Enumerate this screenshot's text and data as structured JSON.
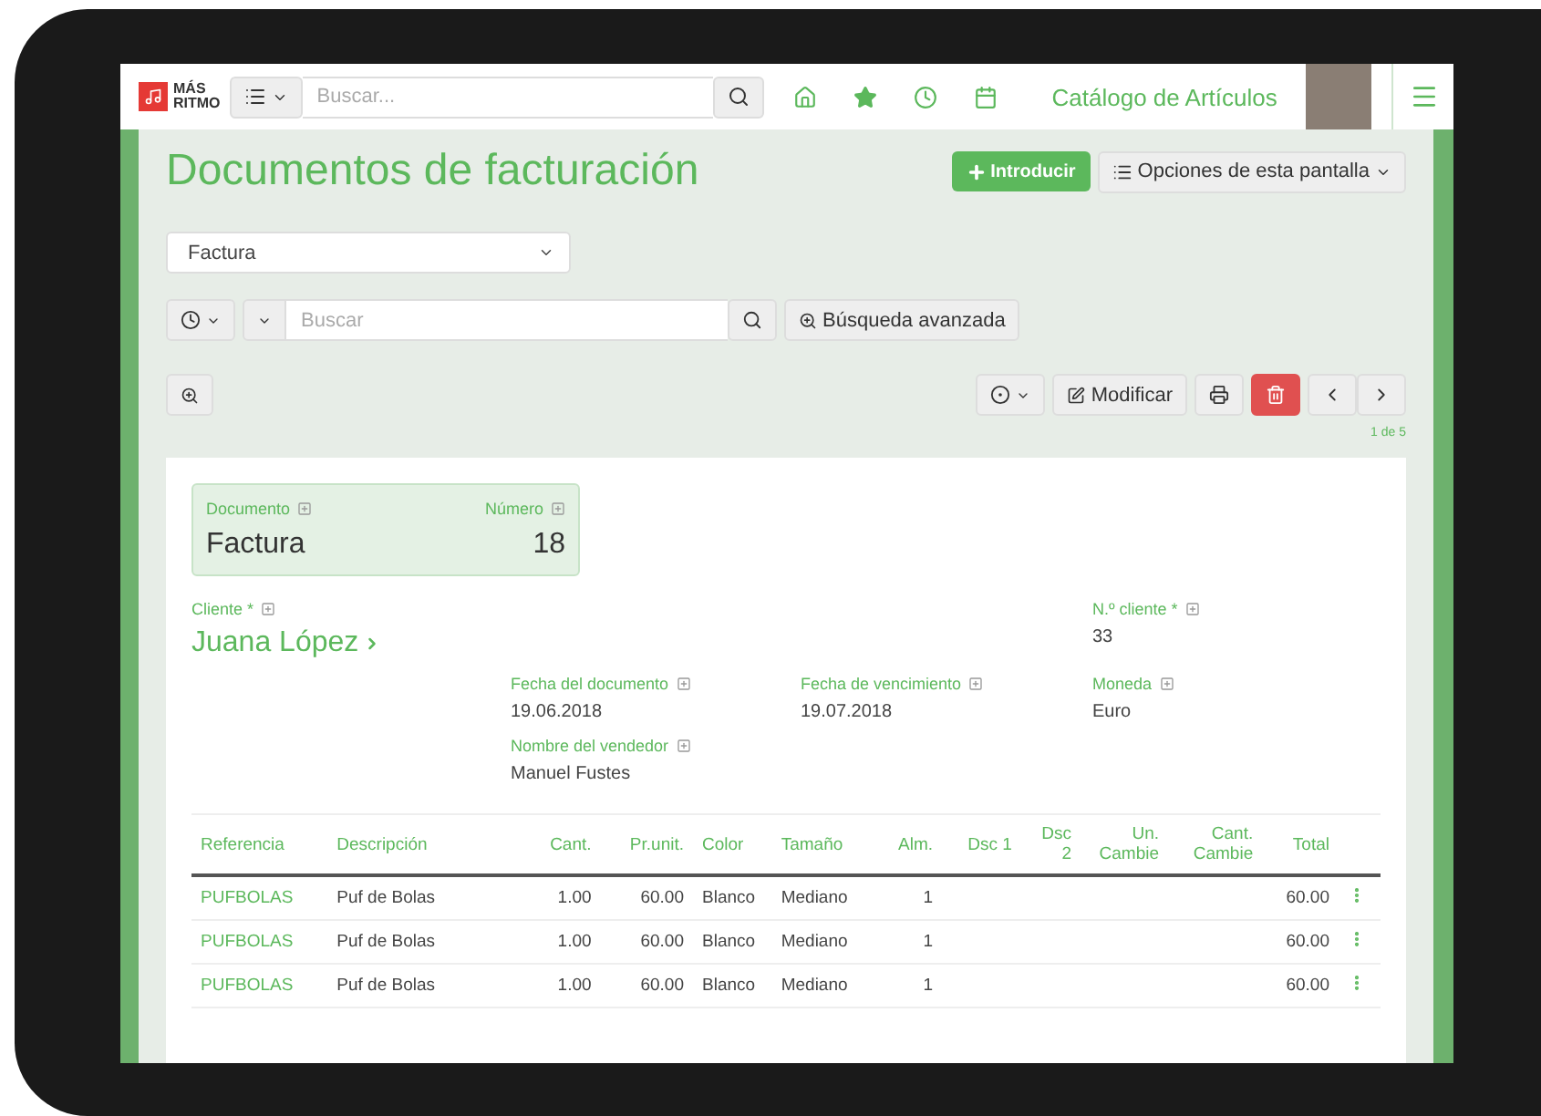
{
  "navbar": {
    "logo_lines": [
      "MÁS",
      "RITMO"
    ],
    "search_placeholder": "Buscar...",
    "module_title": "Catálogo de Artículos"
  },
  "page": {
    "title": "Documentos de facturación",
    "primary_button": "Introducir",
    "options_button": "Opciones de esta pantalla"
  },
  "doc_type_select": {
    "value": "Factura"
  },
  "search": {
    "placeholder": "Buscar",
    "advanced_button": "Búsqueda avanzada"
  },
  "toolbar": {
    "edit_button": "Modificar",
    "pager": "1 de 5"
  },
  "record": {
    "header_fields": [
      {
        "label": "Documento",
        "value": "Factura"
      },
      {
        "label": "Número",
        "value": "18"
      }
    ],
    "fields": [
      {
        "label": "Cliente *",
        "value": "Juana López",
        "kind": "link"
      },
      {
        "label": "N.º cliente *",
        "value": "33",
        "kind": "text"
      },
      {
        "label": "Fecha del documento",
        "value": "19.06.2018",
        "kind": "text"
      },
      {
        "label": "Fecha de vencimiento",
        "value": "19.07.2018",
        "kind": "text"
      },
      {
        "label": "Moneda",
        "value": "Euro",
        "kind": "text"
      },
      {
        "label": "Nombre del vendedor",
        "value": "Manuel Fustes",
        "kind": "text"
      }
    ]
  },
  "table": {
    "columns": [
      "Referencia",
      "Descripción",
      "Cant.",
      "Pr.unit.",
      "Color",
      "Tamaño",
      "Alm.",
      "Dsc 1",
      "Dsc 2",
      "Un. Cambie",
      "Cant. Cambie",
      "Total"
    ],
    "rows": [
      [
        "PUFBOLAS",
        "Puf de Bolas",
        "1.00",
        "60.00",
        "Blanco",
        "Mediano",
        "1",
        "",
        "",
        "",
        "",
        "60.00"
      ],
      [
        "PUFBOLAS",
        "Puf de Bolas",
        "1.00",
        "60.00",
        "Blanco",
        "Mediano",
        "1",
        "",
        "",
        "",
        "",
        "60.00"
      ],
      [
        "PUFBOLAS",
        "Puf de Bolas",
        "1.00",
        "60.00",
        "Blanco",
        "Mediano",
        "1",
        "",
        "",
        "",
        "",
        "60.00"
      ]
    ]
  }
}
